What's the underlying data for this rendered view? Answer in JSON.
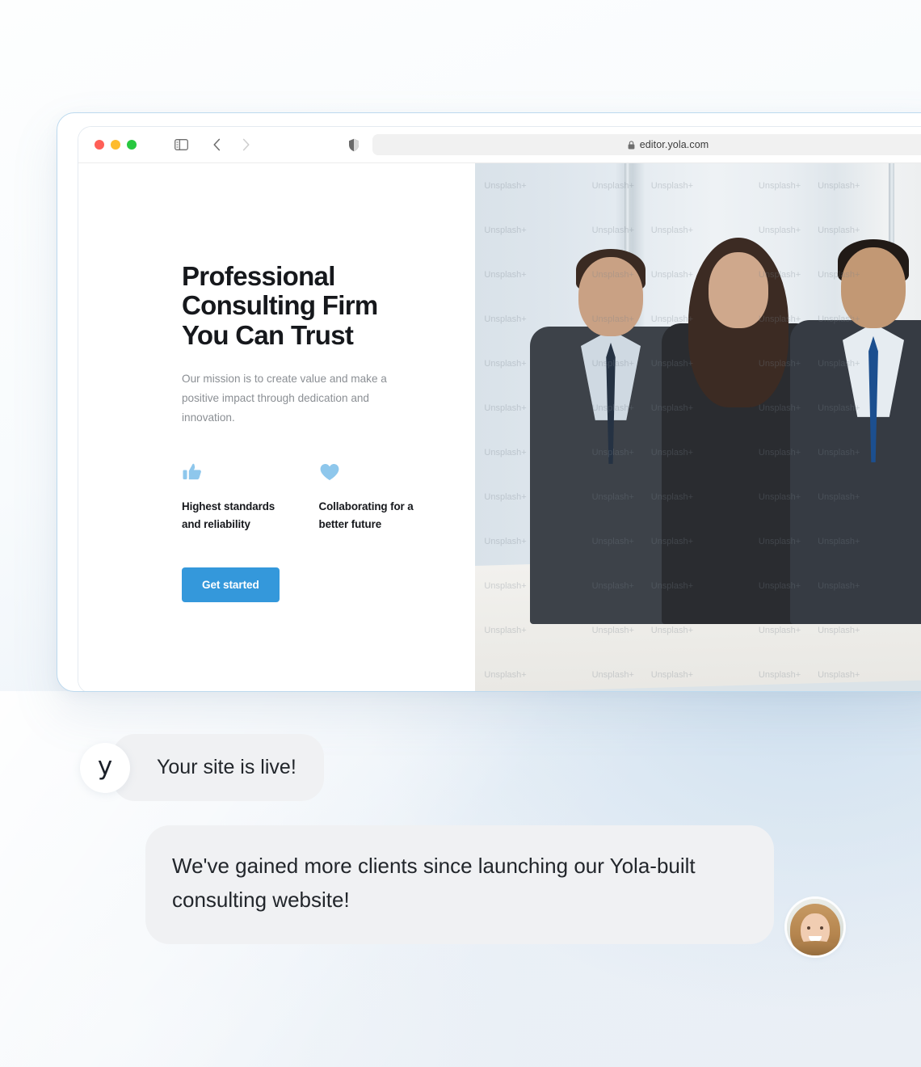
{
  "browser": {
    "traffic_lights": [
      "close",
      "minimize",
      "maximize"
    ],
    "sidebar_icon": "sidebar-toggle-icon",
    "back_icon": "chevron-left-icon",
    "forward_icon": "chevron-right-icon",
    "shield_icon": "shield-icon",
    "lock_icon": "lock-icon",
    "url": "editor.yola.com",
    "reload_icon": "reload-icon"
  },
  "site": {
    "hero": {
      "title": "Professional Consulting Firm You Can Trust",
      "subtitle": "Our mission is to create value and make a positive impact through dedication and innovation.",
      "cta_label": "Get started",
      "cta_color": "#3498db",
      "features": [
        {
          "icon": "thumbs-up-icon",
          "label": "Highest standards and reliability"
        },
        {
          "icon": "heart-icon",
          "label": "Collaborating for a better future"
        }
      ]
    },
    "hero_image": {
      "alt": "Three business professionals standing in an office",
      "watermark": "Unsplash+",
      "watermark_count": 42
    }
  },
  "chat": {
    "messages": [
      {
        "avatar": "yola-logo-avatar",
        "avatar_glyph": "y",
        "text": "Your site is live!"
      },
      {
        "avatar": "customer-photo-avatar",
        "text": "We've gained more clients since launching our Yola-built consulting website!"
      }
    ]
  },
  "colors": {
    "accent": "#3498db",
    "feature_icon": "#8ec7ec",
    "bubble_bg": "#f0f1f3",
    "window_border": "#bcd9ee",
    "heading": "#16181c",
    "body_text": "#8b8f94"
  }
}
